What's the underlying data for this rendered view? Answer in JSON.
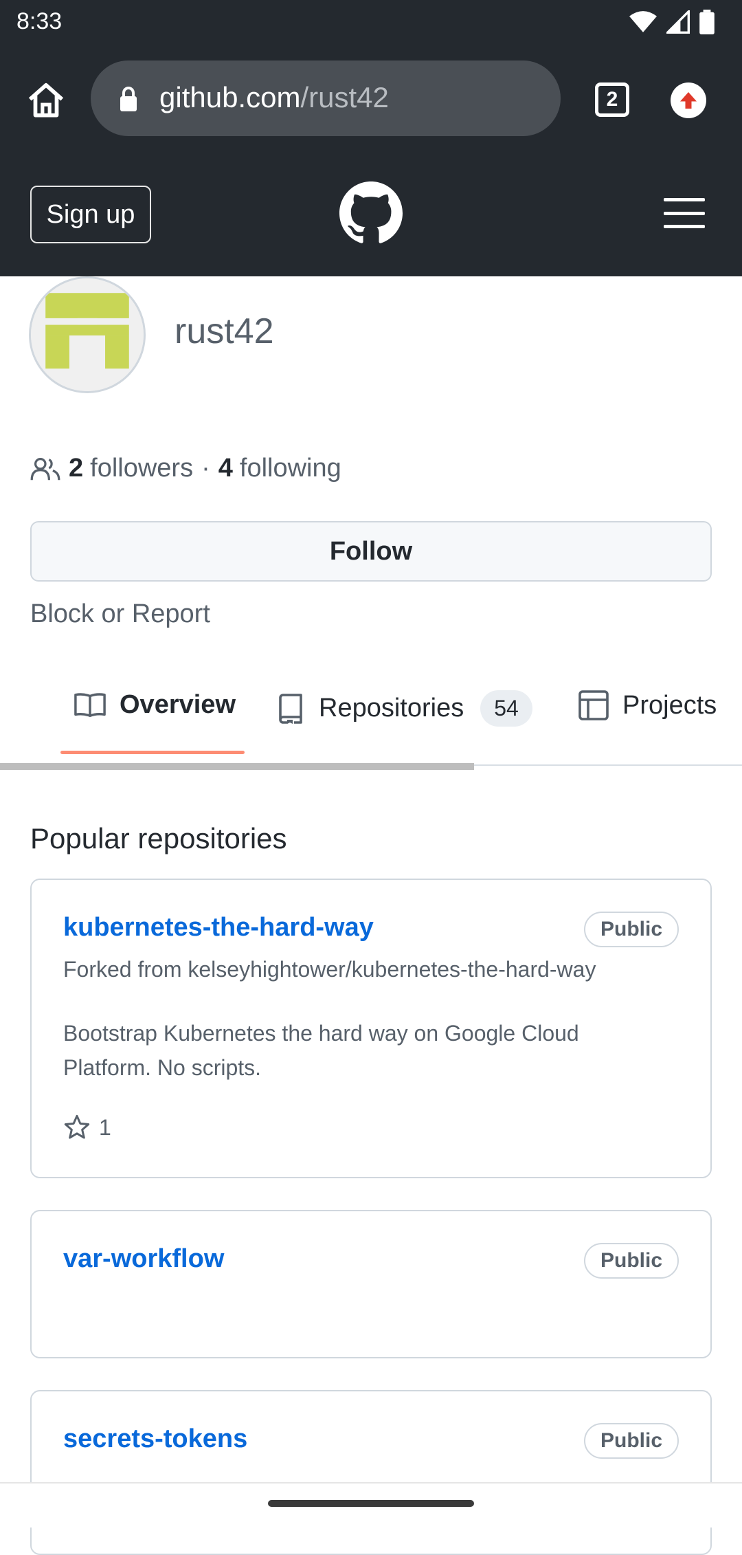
{
  "status_bar": {
    "time": "8:33"
  },
  "browser": {
    "url_host": "github.com",
    "url_path": "/rust42",
    "tab_count": "2"
  },
  "header": {
    "signup_label": "Sign up"
  },
  "profile": {
    "username": "rust42",
    "followers_count": "2",
    "followers_label": "followers",
    "separator": "·",
    "following_count": "4",
    "following_label": "following",
    "follow_label": "Follow",
    "block_report_label": "Block or Report"
  },
  "tabs": {
    "overview": "Overview",
    "repositories": "Repositories",
    "repositories_count": "54",
    "projects": "Projects"
  },
  "popular": {
    "title": "Popular repositories",
    "repos": [
      {
        "name": "kubernetes-the-hard-way",
        "visibility": "Public",
        "forked_from": "Forked from kelseyhightower/kubernetes-the-hard-way",
        "description": "Bootstrap Kubernetes the hard way on Google Cloud Platform. No scripts.",
        "stars": "1"
      },
      {
        "name": "var-workflow",
        "visibility": "Public"
      },
      {
        "name": "secrets-tokens",
        "visibility": "Public"
      }
    ]
  },
  "colors": {
    "header_bg": "#24292f",
    "link": "#0969da",
    "tab_underline": "#fd8c73",
    "avatar_identicon": "#c8d656"
  }
}
